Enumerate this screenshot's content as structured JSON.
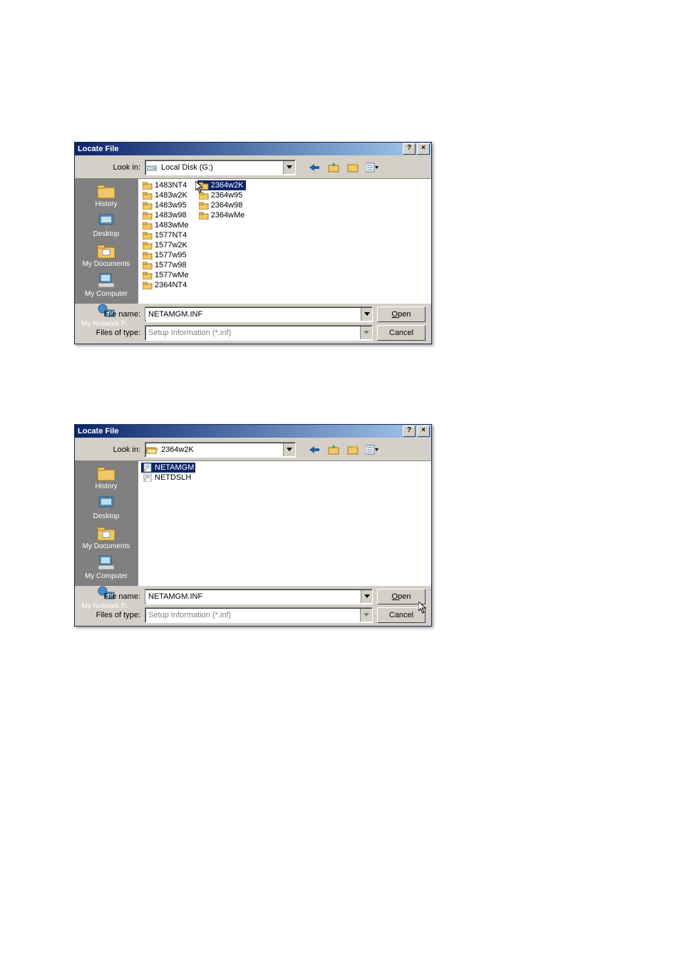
{
  "dialog1": {
    "title": "Locate File",
    "look_in_label": "Look in:",
    "look_in_value": "Local Disk (G:)",
    "places": [
      {
        "name": "history",
        "label": "History"
      },
      {
        "name": "desktop",
        "label": "Desktop"
      },
      {
        "name": "mydocs",
        "label": "My Documents"
      },
      {
        "name": "mycomputer",
        "label": "My Computer"
      },
      {
        "name": "mynetwork",
        "label": "My Network P..."
      }
    ],
    "columns": [
      {
        "items": [
          {
            "label": "1483NT4"
          },
          {
            "label": "1483w2K"
          },
          {
            "label": "1483w95"
          },
          {
            "label": "1483w98"
          },
          {
            "label": "1483wMe"
          },
          {
            "label": "1577NT4"
          },
          {
            "label": "1577w2K"
          },
          {
            "label": "1577w95"
          },
          {
            "label": "1577w98"
          },
          {
            "label": "1577wMe"
          },
          {
            "label": "2364NT4"
          }
        ]
      },
      {
        "items": [
          {
            "label": "2364w2K",
            "selected": true
          },
          {
            "label": "2364w95"
          },
          {
            "label": "2364w98"
          },
          {
            "label": "2364wMe"
          }
        ]
      }
    ],
    "file_name_label": "File name:",
    "file_name_value": "NETAMGM.INF",
    "file_type_label": "Files of type:",
    "file_type_value": "Setup Information (*.inf)",
    "open_label": "Open",
    "cancel_label": "Cancel"
  },
  "dialog2": {
    "title": "Locate File",
    "look_in_label": "Look in:",
    "look_in_value": "2364w2K",
    "places": [
      {
        "name": "history",
        "label": "History"
      },
      {
        "name": "desktop",
        "label": "Desktop"
      },
      {
        "name": "mydocs",
        "label": "My Documents"
      },
      {
        "name": "mycomputer",
        "label": "My Computer"
      },
      {
        "name": "mynetwork",
        "label": "My Network P..."
      }
    ],
    "columns": [
      {
        "items": [
          {
            "label": "NETAMGM",
            "type": "file",
            "selected": true
          },
          {
            "label": "NETDSLH",
            "type": "file"
          }
        ]
      }
    ],
    "file_name_label": "File name:",
    "file_name_value": "NETAMGM.INF",
    "file_type_label": "Files of type:",
    "file_type_value": "Setup Information (*.inf)",
    "open_label": "Open",
    "cancel_label": "Cancel"
  }
}
